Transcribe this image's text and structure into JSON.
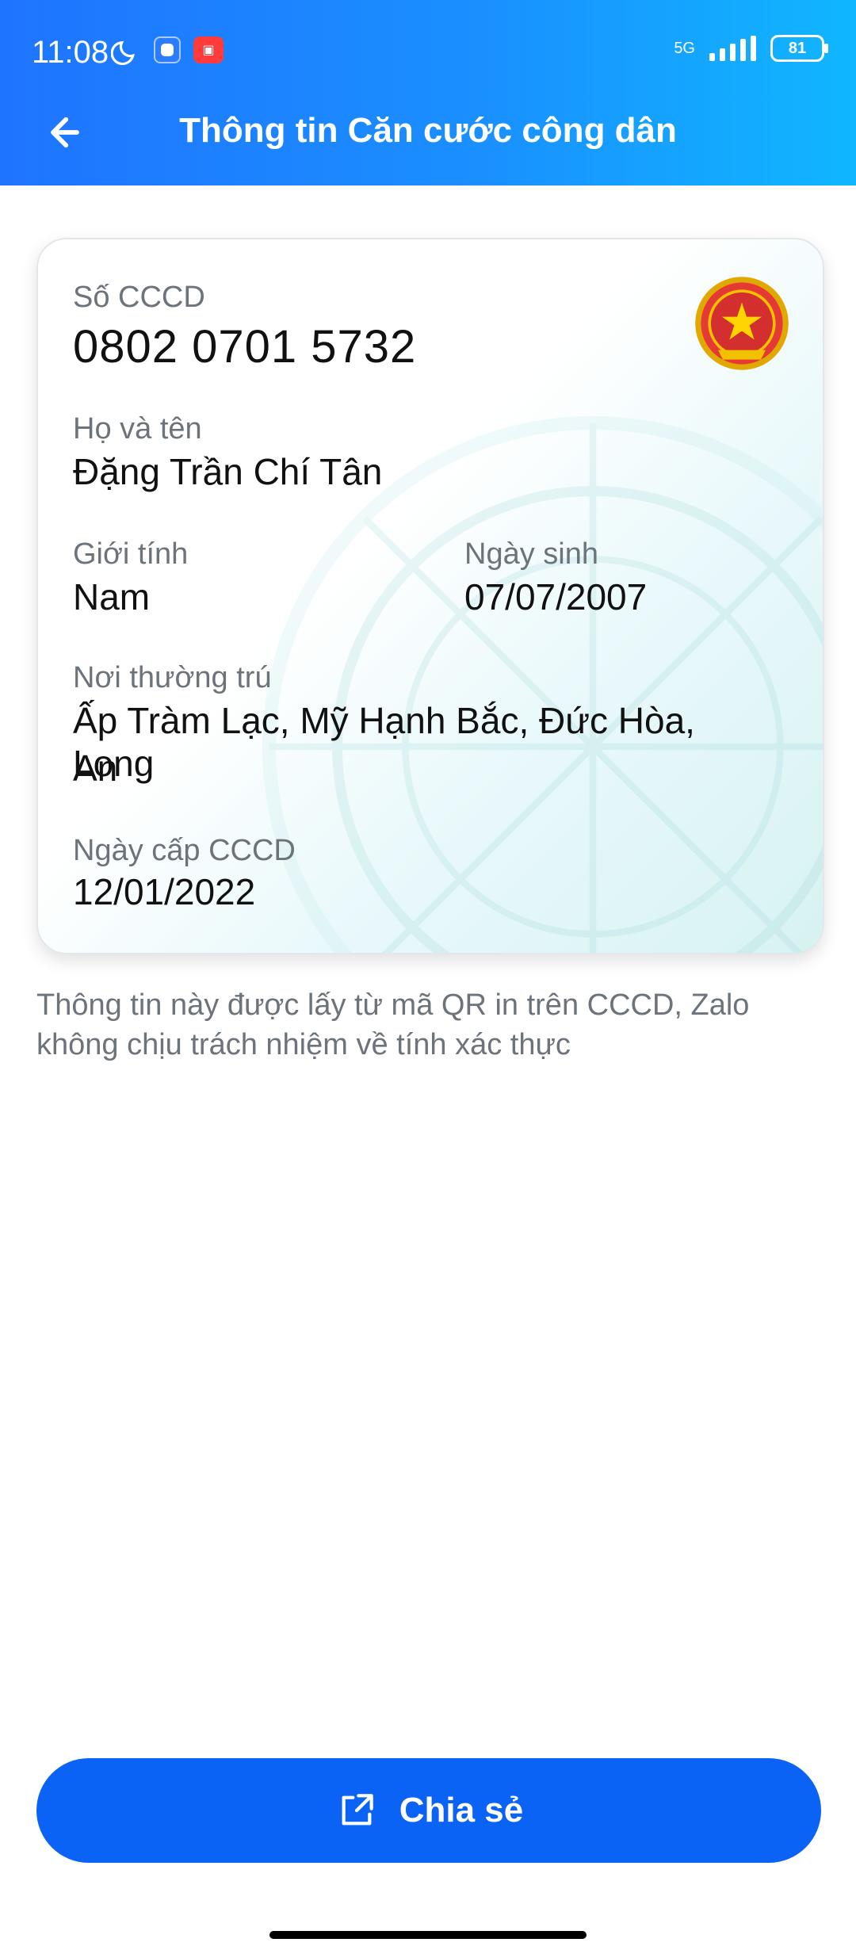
{
  "status_bar": {
    "time": "11:08",
    "network": "5G",
    "battery": "81"
  },
  "header": {
    "title": "Thông tin Căn cước công dân"
  },
  "card": {
    "id_label": "Số CCCD",
    "id_value": "0802 0701 5732",
    "name_label": "Họ và tên",
    "name_value": "Đặng Trần Chí Tân",
    "gender_label": "Giới tính",
    "gender_value": "Nam",
    "dob_label": "Ngày sinh",
    "dob_value": "07/07/2007",
    "address_label": "Nơi thường trú",
    "address_value_line1": "Ấp Tràm Lạc, Mỹ Hạnh Bắc, Đức Hòa, Long",
    "address_value_line2": "An",
    "issue_label": "Ngày cấp CCCD",
    "issue_value": "12/01/2022"
  },
  "note": {
    "line1": "Thông tin này được lấy từ mã QR in trên CCCD, Zalo",
    "line2": "không chịu trách nhiệm về tính xác thực"
  },
  "actions": {
    "share_label": "Chia sẻ"
  },
  "colors": {
    "primary": "#0B63F6",
    "header_start": "#1F74FF",
    "header_end": "#10B6FF",
    "label_gray": "#6C737A"
  },
  "icons": {
    "back": "arrow-left-icon",
    "share": "share-icon",
    "emblem": "national-emblem-icon"
  }
}
